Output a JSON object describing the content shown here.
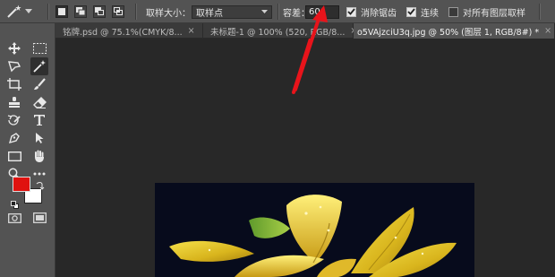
{
  "options_bar": {
    "sample_size_label": "取样大小：",
    "sample_size_value": "取样点",
    "tolerance_label": "容差：",
    "tolerance_value": "60",
    "antialias_label": "消除锯齿",
    "antialias_checked": true,
    "contiguous_label": "连续",
    "contiguous_checked": true,
    "sample_all_layers_label": "对所有图层取样",
    "sample_all_layers_checked": false
  },
  "tabs": [
    {
      "label": "铭牌.psd @ 75.1%(CMYK/8...",
      "close": "×",
      "active": false
    },
    {
      "label": "未标题-1 @ 100% (520, RGB/8...",
      "close": "×",
      "active": false
    },
    {
      "label": "o5VAjzciU3q.jpg @ 50% (图层 1, RGB/8#) *",
      "close": "×",
      "active": true
    }
  ],
  "colors": {
    "foreground": "#e0120f",
    "background": "#ffffff",
    "annotation_arrow": "#e8141b"
  },
  "tools": [
    "move-tool",
    "rectangular-marquee-tool",
    "lasso-tool",
    "magic-wand-tool",
    "eyedropper-tool",
    "brush-tool",
    "clone-stamp-tool",
    "eraser-tool",
    "history-brush-tool",
    "type-tool",
    "pen-tool",
    "path-selection-tool",
    "rectangle-tool",
    "hand-tool",
    "zoom-tool",
    "more-tools"
  ]
}
